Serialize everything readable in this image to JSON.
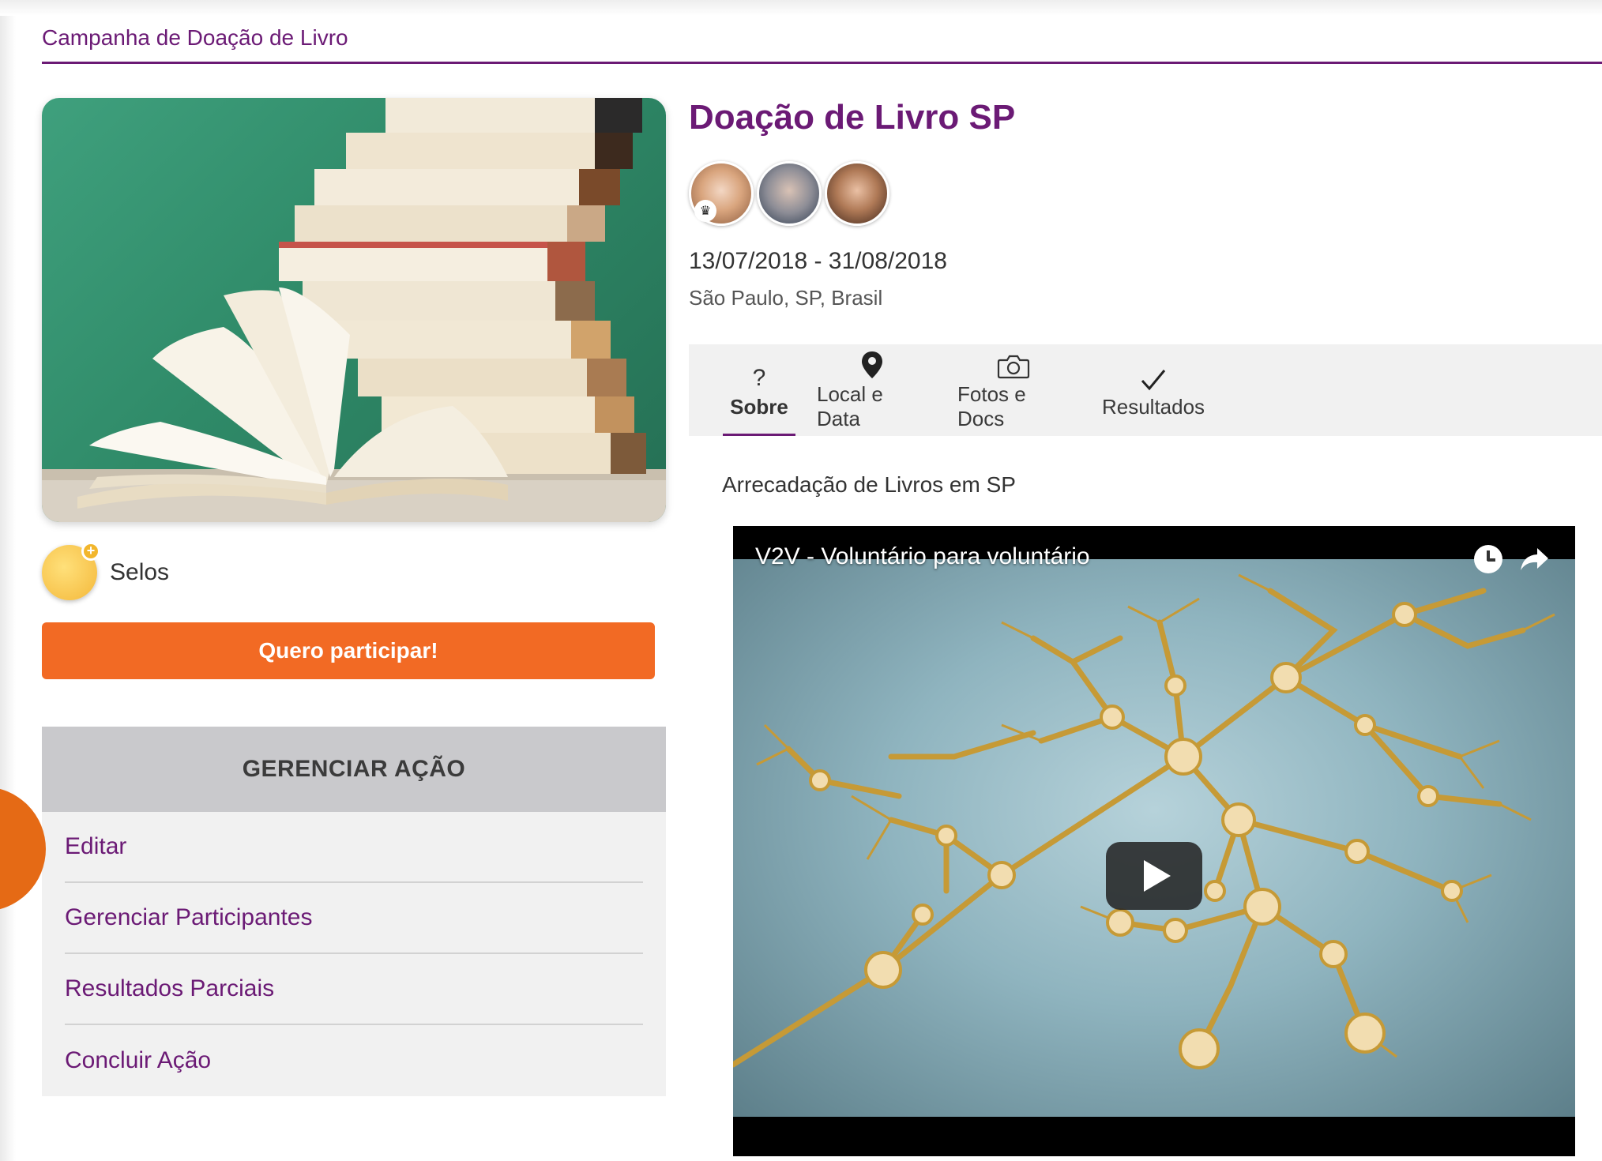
{
  "breadcrumb": {
    "label": "Campanha de Doação de Livro"
  },
  "event": {
    "title": "Doação de Livro SP",
    "dates": "13/07/2018 - 31/08/2018",
    "location": "São Paulo, SP, Brasil",
    "subtitle": "Arrecadação de Livros em SP"
  },
  "participants": [
    {
      "icon": "avatar",
      "role": "organizer",
      "badge_icon": "crown-icon"
    },
    {
      "icon": "avatar"
    },
    {
      "icon": "avatar"
    }
  ],
  "badges": {
    "label": "Selos",
    "icon": "badge-add-icon"
  },
  "cta": {
    "label": "Quero participar!"
  },
  "manage": {
    "title": "GERENCIAR AÇÃO",
    "items": [
      {
        "label": "Editar"
      },
      {
        "label": "Gerenciar Participantes"
      },
      {
        "label": "Resultados Parciais"
      },
      {
        "label": "Concluir Ação"
      }
    ]
  },
  "tabs": [
    {
      "label": "Sobre",
      "icon": "question-icon",
      "active": true
    },
    {
      "label": "Local e Data",
      "icon": "map-pin-icon",
      "active": false
    },
    {
      "label": "Fotos e Docs",
      "icon": "camera-icon",
      "active": false
    },
    {
      "label": "Resultados",
      "icon": "checkmark-icon",
      "active": false
    }
  ],
  "video": {
    "title": "V2V - Voluntário para voluntário",
    "icons": [
      "watch-later-icon",
      "share-icon",
      "play-icon"
    ]
  },
  "colors": {
    "brand_purple": "#6b1a75",
    "cta_orange": "#f26a24",
    "panel_gray": "#f1f1f1",
    "panel_header_gray": "#c9c9cc"
  }
}
